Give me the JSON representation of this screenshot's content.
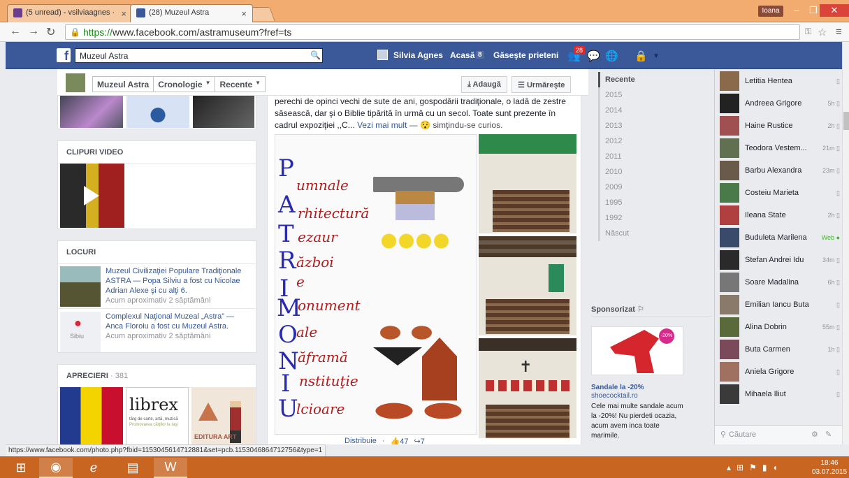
{
  "browser": {
    "tabs": [
      {
        "label": "(5 unread) - vsilviaagnes ·",
        "icon": "gmail-icon",
        "active": false
      },
      {
        "label": "(28) Muzeul Astra",
        "icon": "facebook-icon",
        "active": true
      }
    ],
    "user": "Ioana",
    "url_scheme": "https://",
    "url_rest": "www.facebook.com/astramuseum?fref=ts"
  },
  "facebook": {
    "search_value": "Muzeul Astra",
    "user_name": "Silvia Agnes",
    "nav_home": "Acasă",
    "nav_home_count": "8",
    "nav_friends": "Găseşte prieteni",
    "friend_requests": "28"
  },
  "page_header": {
    "tabs": [
      "Muzeul Astra",
      "Cronologie",
      "Recente"
    ],
    "add_label": "Adaugă",
    "follow_label": "Urmăreşte"
  },
  "left": {
    "videos_title": "CLIPURI VIDEO",
    "places_title": "LOCURI",
    "places": [
      {
        "text": "Muzeul Civilizaţiei Populare Tradiţionale ASTRA — Popa Silviu a fost cu Nicolae Adrian Alexe şi cu alţi 6.",
        "time": "Acum aproximativ 2 săptămâni"
      },
      {
        "text": "Complexul Naţional Muzeal „Astra” — Anca Floroiu a fost cu Muzeul Astra.",
        "time": "Acum aproximativ 2 săptămâni",
        "map_label": "Sibiu"
      }
    ],
    "likes_title": "APRECIERI",
    "likes_count": "381",
    "likes_page_name": "librex",
    "likes_page_sub": "târg de carte, artă, muzică",
    "likes_page_sub2": "Promovarea cărţilor la Iaşi",
    "likes_page3": "EDITURA ART"
  },
  "post": {
    "text": "perechi de opinci vechi de sute de ani, gospodării tradiţionale, o ladă de zestre săsească, dar şi o Biblie tipărită în urmă cu un secol. Toate sunt prezente în cadrul expoziţiei ,,C...",
    "more_label": "Vezi mai mult",
    "feeling": "— 😯 simţindu-se curios.",
    "poster_vertical": [
      "P",
      "A",
      "T",
      "R",
      "I",
      "M",
      "O",
      "N",
      "I",
      "U"
    ],
    "poster_lines": [
      "umnale",
      "rhitectură",
      "ezaur",
      "ăzboi",
      "e",
      "onument",
      "ale",
      "ăframă",
      "nstituţie",
      "lcioare"
    ],
    "share_label": "Distribuie",
    "likes": "47",
    "shares": "7"
  },
  "timeline": {
    "items": [
      "Recente",
      "2015",
      "2014",
      "2013",
      "2012",
      "2011",
      "2010",
      "2009",
      "1995",
      "1992",
      "Născut"
    ]
  },
  "sponsor": {
    "title": "Sponsorizat",
    "ad_title": "Sandale la -20%",
    "ad_url": "shoecocktail.ro",
    "ad_desc": "Cele mai multe sandale acum la -20%! Nu pierdeti ocazia, acum avem inca toate marimile.",
    "badge": "-20%"
  },
  "chat": {
    "contacts": [
      {
        "name": "Letitia Hentea",
        "status": ""
      },
      {
        "name": "Andreea Grigore",
        "status": "5h"
      },
      {
        "name": "Haine Rustice",
        "status": "2h"
      },
      {
        "name": "Teodora Vestem...",
        "status": "21m"
      },
      {
        "name": "Barbu Alexandra",
        "status": "23m"
      },
      {
        "name": "Costeiu Marieta",
        "status": ""
      },
      {
        "name": "Ileana State",
        "status": "2h"
      },
      {
        "name": "Buduleta Marilena",
        "status": "Web"
      },
      {
        "name": "Stefan Andrei Idu",
        "status": "34m"
      },
      {
        "name": "Soare Madalina",
        "status": "6h"
      },
      {
        "name": "Emilian Iancu Buta",
        "status": ""
      },
      {
        "name": "Alina Dobrin",
        "status": "55m"
      },
      {
        "name": "Buta Carmen",
        "status": "1h"
      },
      {
        "name": "Aniela Grigore",
        "status": ""
      },
      {
        "name": "Mihaela Iliut",
        "status": ""
      }
    ],
    "search_placeholder": "Căutare"
  },
  "status_url": "https://www.facebook.com/photo.php?fbid=1153045614712881&set=pcb.1153046864712756&type=1",
  "taskbar": {
    "time": "18:46",
    "date": "03.07.2015"
  },
  "colors": {
    "facebook_blue": "#3b5998",
    "link": "#365899",
    "tabbar": "#f3ac6f",
    "taskbar": "#c76521"
  }
}
